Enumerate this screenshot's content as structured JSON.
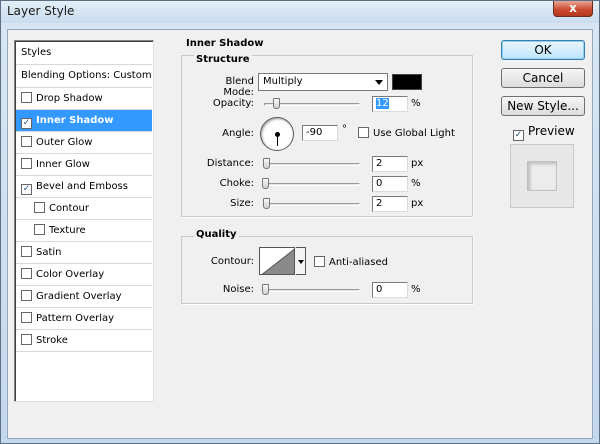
{
  "window": {
    "title": "Layer Style",
    "close_label": "x"
  },
  "styles_list": {
    "header": "Styles",
    "blending": "Blending Options: Custom",
    "items": [
      {
        "label": "Drop Shadow",
        "checked": false,
        "selected": false,
        "sub": false
      },
      {
        "label": "Inner Shadow",
        "checked": true,
        "selected": true,
        "sub": false
      },
      {
        "label": "Outer Glow",
        "checked": false,
        "selected": false,
        "sub": false
      },
      {
        "label": "Inner Glow",
        "checked": false,
        "selected": false,
        "sub": false
      },
      {
        "label": "Bevel and Emboss",
        "checked": true,
        "selected": false,
        "sub": false
      },
      {
        "label": "Contour",
        "checked": false,
        "selected": false,
        "sub": true
      },
      {
        "label": "Texture",
        "checked": false,
        "selected": false,
        "sub": true
      },
      {
        "label": "Satin",
        "checked": false,
        "selected": false,
        "sub": false
      },
      {
        "label": "Color Overlay",
        "checked": false,
        "selected": false,
        "sub": false
      },
      {
        "label": "Gradient Overlay",
        "checked": false,
        "selected": false,
        "sub": false
      },
      {
        "label": "Pattern Overlay",
        "checked": false,
        "selected": false,
        "sub": false
      },
      {
        "label": "Stroke",
        "checked": false,
        "selected": false,
        "sub": false
      }
    ]
  },
  "inner_shadow": {
    "title": "Inner Shadow",
    "structure": {
      "title": "Structure",
      "blend_mode_label": "Blend Mode:",
      "blend_mode_value": "Multiply",
      "shadow_color": "#000000",
      "opacity_label": "Opacity:",
      "opacity_value": "12",
      "opacity_unit": "%",
      "opacity_fraction": 0.12,
      "angle_label": "Angle:",
      "angle_value": "-90",
      "angle_unit": "°",
      "use_global_light_label": "Use Global Light",
      "use_global_light": false,
      "distance_label": "Distance:",
      "distance_value": "2",
      "distance_unit": "px",
      "distance_fraction": 0.01,
      "choke_label": "Choke:",
      "choke_value": "0",
      "choke_unit": "%",
      "choke_fraction": 0,
      "size_label": "Size:",
      "size_value": "2",
      "size_unit": "px",
      "size_fraction": 0.01
    },
    "quality": {
      "title": "Quality",
      "contour_label": "Contour:",
      "anti_aliased_label": "Anti-aliased",
      "anti_aliased": false,
      "noise_label": "Noise:",
      "noise_value": "0",
      "noise_unit": "%",
      "noise_fraction": 0
    }
  },
  "buttons": {
    "ok": "OK",
    "cancel": "Cancel",
    "new_style": "New Style...",
    "preview_label": "Preview",
    "preview_checked": true
  },
  "icons": {
    "checkbox_checked": "check-icon",
    "dropdown": "chevron-down-icon",
    "angle_dial": "angle-dial-icon",
    "contour_preview": "linear-contour-icon"
  }
}
